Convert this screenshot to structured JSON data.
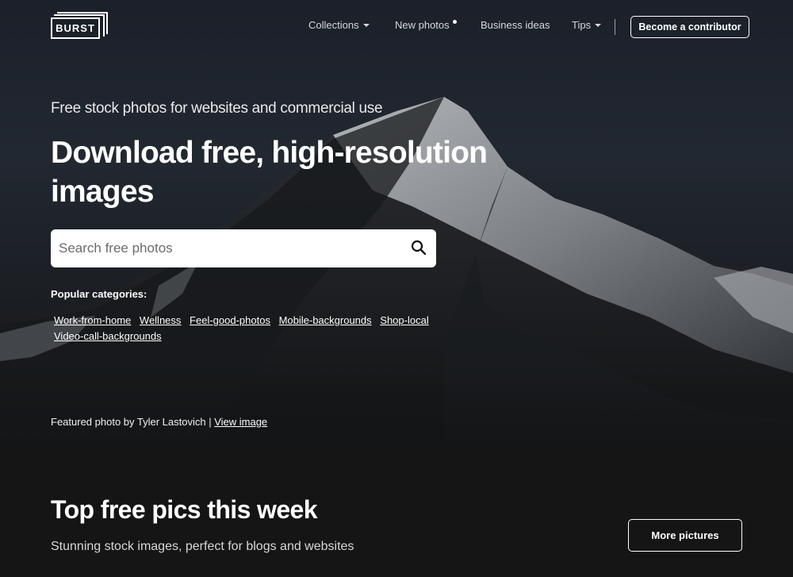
{
  "brand": {
    "logo_text": "BURST"
  },
  "nav": {
    "items": [
      {
        "label": "Collections",
        "has_dropdown": true
      },
      {
        "label": "New photos",
        "has_dot": true
      },
      {
        "label": "Business ideas"
      },
      {
        "label": "Tips",
        "has_dropdown": true
      }
    ],
    "cta_label": "Become a contributor"
  },
  "hero": {
    "subtitle": "Free stock photos for websites and commercial use",
    "headline": "Download free, high-resolution images",
    "search_placeholder": "Search free photos",
    "popular_label": "Popular categories:",
    "categories": [
      "Work-from-home",
      "Wellness",
      "Feel-good-photos",
      "Mobile-backgrounds",
      "Shop-local",
      "Video-call-backgrounds"
    ],
    "credit_text": "Featured photo by Tyler Lastovich | ",
    "credit_link": "View image"
  },
  "section": {
    "title": "Top free pics this week",
    "subtitle": "Stunning stock images, perfect for blogs and websites",
    "button_label": "More pictures"
  },
  "colors": {
    "page_bg": "#151515",
    "hero_sky": "#222831",
    "text": "#ffffff"
  }
}
